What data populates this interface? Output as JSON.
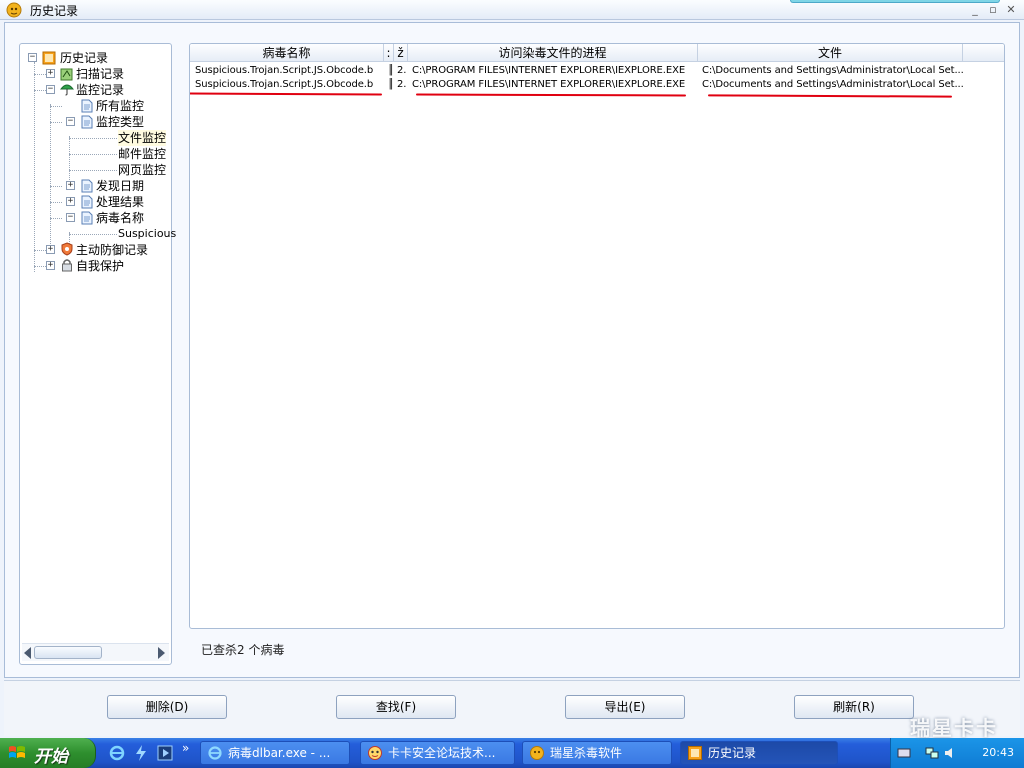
{
  "window": {
    "title": "历史记录",
    "controls": [
      "_",
      "▫",
      "✕"
    ]
  },
  "tree": {
    "root": "历史记录",
    "items": [
      {
        "label": "扫描记录",
        "icon": "scan-log-icon"
      },
      {
        "label": "监控记录",
        "icon": "umbrella-icon"
      },
      {
        "label": "所有监控",
        "icon": "document-icon"
      },
      {
        "label": "监控类型",
        "icon": "document-icon"
      },
      {
        "label": "文件监控"
      },
      {
        "label": "邮件监控"
      },
      {
        "label": "网页监控"
      },
      {
        "label": "发现日期",
        "icon": "document-icon"
      },
      {
        "label": "处理结果",
        "icon": "document-icon"
      },
      {
        "label": "病毒名称",
        "icon": "document-icon"
      },
      {
        "label": "Suspicious"
      },
      {
        "label": "主动防御记录",
        "icon": "shield-icon"
      },
      {
        "label": "自我保护",
        "icon": "lock-icon"
      }
    ]
  },
  "list": {
    "columns": [
      "病毒名称",
      ":",
      "ž",
      "访问染毒文件的进程",
      "文件"
    ],
    "rows": [
      {
        "virus": "Suspicious.Trojan.Script.JS.Obcode.b",
        "c1": "║",
        "c2": "2.",
        "process": "C:\\PROGRAM FILES\\INTERNET EXPLORER\\IEXPLORE.EXE",
        "file": "C:\\Documents and Settings\\Administrator\\Local Set..."
      },
      {
        "virus": "Suspicious.Trojan.Script.JS.Obcode.b",
        "c1": "║",
        "c2": "2.",
        "process": "C:\\PROGRAM FILES\\INTERNET EXPLORER\\IEXPLORE.EXE",
        "file": "C:\\Documents and Settings\\Administrator\\Local Set..."
      }
    ]
  },
  "status": "已查杀2 个病毒",
  "buttons": {
    "delete": "删除(D)",
    "find": "查找(F)",
    "export": "导出(E)",
    "refresh": "刷新(R)"
  },
  "taskbar": {
    "start": "开始",
    "chevron": "»",
    "tasks": [
      {
        "label": "病毒dlbar.exe - ...",
        "icon": "ie-icon"
      },
      {
        "label": "卡卡安全论坛技术...",
        "icon": "kaka-icon"
      },
      {
        "label": "瑞星杀毒软件",
        "icon": "rising-lion-icon"
      },
      {
        "label": "历史记录",
        "icon": "history-icon",
        "active": true
      }
    ],
    "clock": "20:43"
  },
  "watermark": "瑞星卡卡",
  "colors": {
    "annotation_red": "#e00010",
    "taskbar_blue": "#245edb",
    "start_green": "#2e8f2e"
  }
}
